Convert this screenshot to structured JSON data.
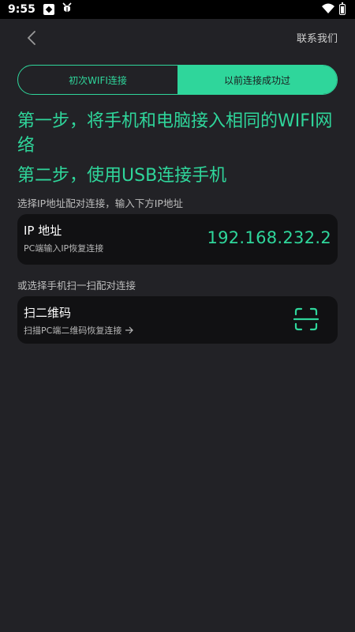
{
  "status_bar": {
    "time": "9:55",
    "icons": [
      "app-notification-icon",
      "bug-icon",
      "wifi-icon",
      "battery-icon"
    ]
  },
  "header": {
    "back_icon": "chevron-left-icon",
    "contact_label": "联系我们"
  },
  "tabs": [
    {
      "label": "初次WIFI连接",
      "active": false
    },
    {
      "label": "以前连接成功过",
      "active": true
    }
  ],
  "steps": {
    "step1": "第一步，将手机和电脑接入相同的WIFI网络",
    "step2": "第二步，使用USB连接手机"
  },
  "ip_section": {
    "hint": "选择IP地址配对连接，输入下方IP地址",
    "title": "IP 地址",
    "subtitle": "PC端输入IP恢复连接",
    "value": "192.168.232.2"
  },
  "qr_section": {
    "hint": "或选择手机扫一扫配对连接",
    "title": "扫二维码",
    "subtitle": "扫描PC端二维码恢复连接",
    "arrow_icon": "arrow-right-icon",
    "scan_icon": "scan-icon"
  },
  "colors": {
    "accent": "#2fd69b",
    "background": "#222226",
    "card": "#111113"
  }
}
